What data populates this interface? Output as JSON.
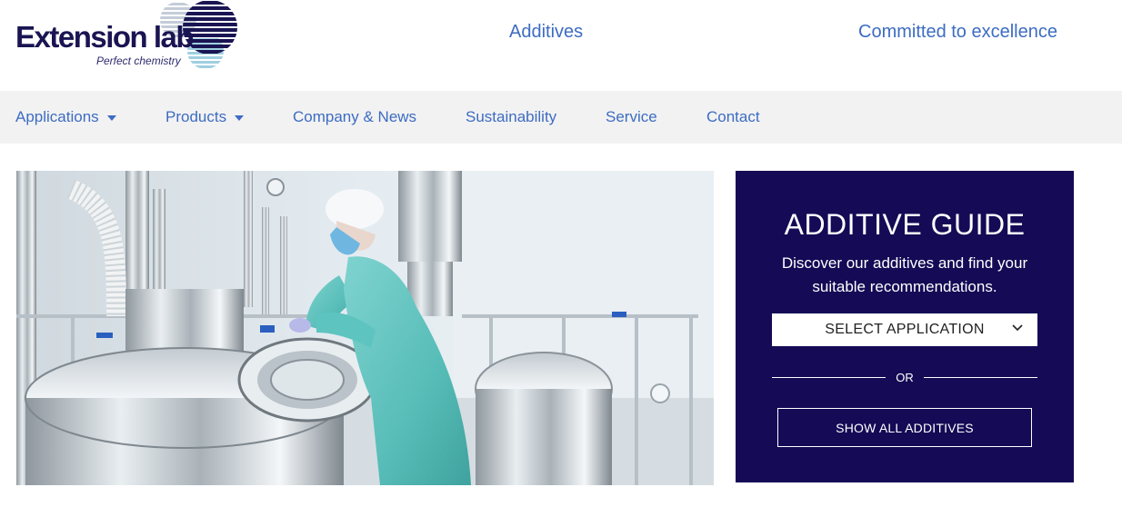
{
  "header": {
    "logo": {
      "name": "Extension lab",
      "tagline": "Perfect chemistry"
    },
    "links": {
      "additives": "Additives",
      "committed": "Committed to excellence"
    }
  },
  "nav": {
    "items": [
      {
        "label": "Applications",
        "dropdown": true
      },
      {
        "label": "Products",
        "dropdown": true
      },
      {
        "label": "Company & News",
        "dropdown": false
      },
      {
        "label": "Sustainability",
        "dropdown": false
      },
      {
        "label": "Service",
        "dropdown": false
      },
      {
        "label": "Contact",
        "dropdown": false
      }
    ]
  },
  "guide": {
    "title": "ADDITIVE GUIDE",
    "description": "Discover our additives and find your suitable recommendations.",
    "select_label": "SELECT APPLICATION",
    "or_label": "OR",
    "show_all_label": "SHOW ALL ADDITIVES"
  },
  "colors": {
    "brand_navy": "#140a55",
    "link_blue": "#3d6cc2",
    "nav_bg": "#f2f2f2",
    "logo_light": "#9fcfe0"
  }
}
